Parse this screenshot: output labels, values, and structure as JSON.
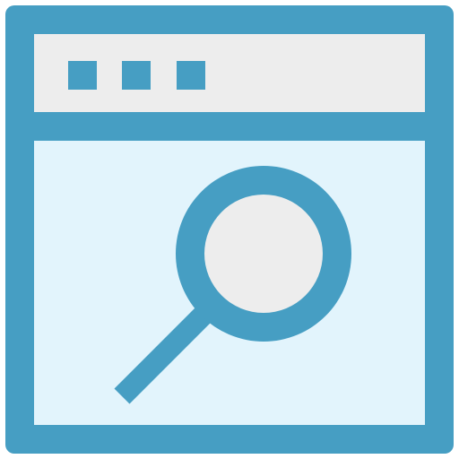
{
  "icon": {
    "name": "browser-search-icon",
    "window_dots": [
      "dot-1",
      "dot-2",
      "dot-3"
    ]
  },
  "colors": {
    "frame": "#469EC3",
    "titlebar_fill": "#EDEDED",
    "content_fill": "#E2F4FC",
    "lens_fill": "#EDEDED",
    "background": "#FFFFFF"
  }
}
